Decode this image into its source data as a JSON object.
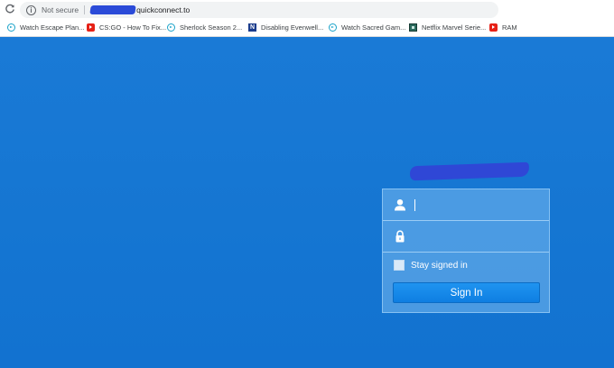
{
  "browser": {
    "security_label": "Not secure",
    "url_domain": "quickconnect.to"
  },
  "bookmarks": [
    {
      "label": "Watch Escape Plan...",
      "icon": "play-circle-icon"
    },
    {
      "label": "CS:GO - How To Fix...",
      "icon": "youtube-icon"
    },
    {
      "label": "Sherlock Season 2...",
      "icon": "play-circle-icon"
    },
    {
      "label": "Disabling Evenwell...",
      "icon": "n-logo-icon"
    },
    {
      "label": "Watch Sacred Gam...",
      "icon": "play-circle-icon"
    },
    {
      "label": "Netflix Marvel Serie...",
      "icon": "film-icon"
    },
    {
      "label": "RAM",
      "icon": "youtube-icon"
    }
  ],
  "login": {
    "username_value": "",
    "password_value": "",
    "stay_signed_in_label": "Stay signed in",
    "stay_signed_in_checked": false,
    "signin_label": "Sign In"
  },
  "colors": {
    "background": "#1576d2",
    "button": "#1589ea",
    "redaction": "#2f47d6"
  }
}
